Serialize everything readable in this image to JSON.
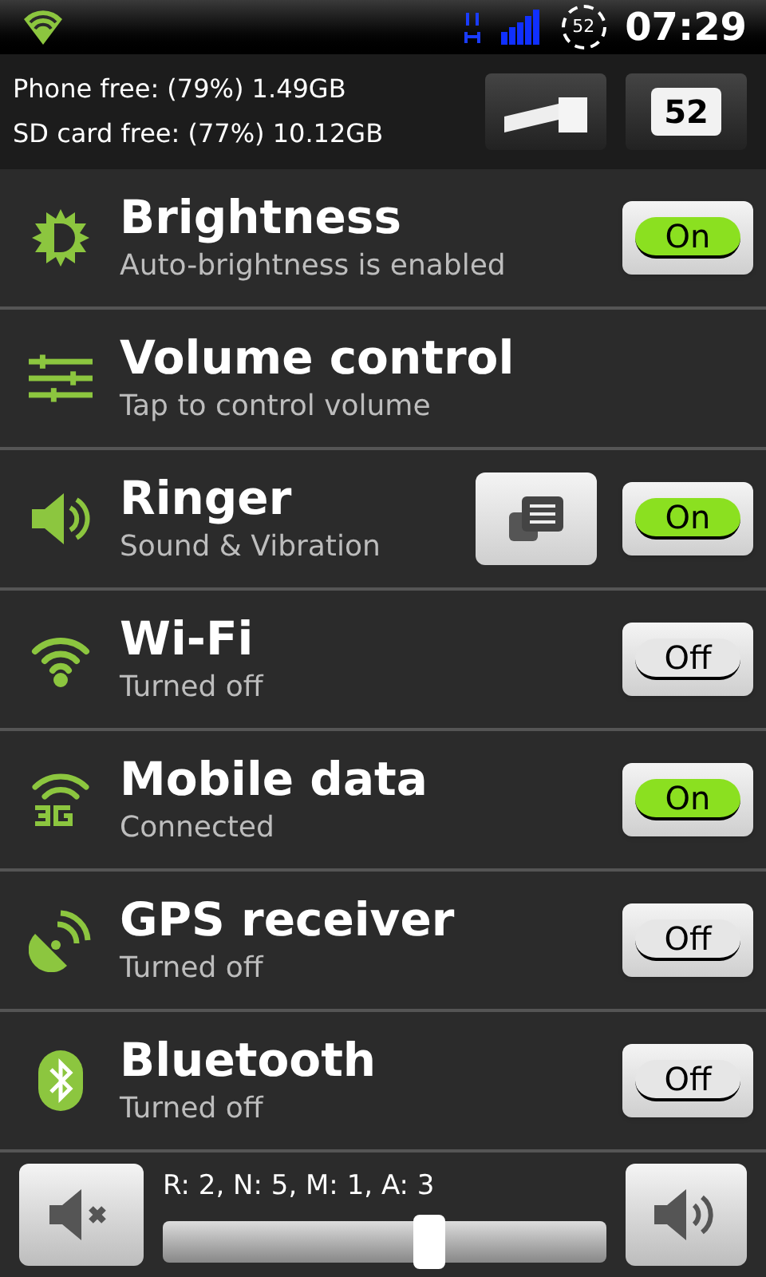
{
  "status_bar": {
    "battery": "52",
    "time": "07:29"
  },
  "storage": {
    "phone": "Phone free: (79%) 1.49GB",
    "sd": "SD card free: (77%) 10.12GB",
    "battery_button": "52"
  },
  "rows": [
    {
      "title": "Brightness",
      "subtitle": "Auto-brightness is enabled",
      "toggle": {
        "label": "On",
        "on": true
      }
    },
    {
      "title": "Volume control",
      "subtitle": "Tap to control volume"
    },
    {
      "title": "Ringer",
      "subtitle": "Sound & Vibration",
      "has_menu_button": true,
      "toggle": {
        "label": "On",
        "on": true
      }
    },
    {
      "title": "Wi-Fi",
      "subtitle": "Turned off",
      "toggle": {
        "label": "Off",
        "on": false
      }
    },
    {
      "title": "Mobile data",
      "subtitle": "Connected",
      "toggle": {
        "label": "On",
        "on": true
      }
    },
    {
      "title": "GPS receiver",
      "subtitle": "Turned off",
      "toggle": {
        "label": "Off",
        "on": false
      }
    },
    {
      "title": "Bluetooth",
      "subtitle": "Turned off",
      "toggle": {
        "label": "Off",
        "on": false
      }
    }
  ],
  "volume": {
    "reading": "R: 2, N: 5, M: 1, A: 3",
    "level": 0.6
  }
}
